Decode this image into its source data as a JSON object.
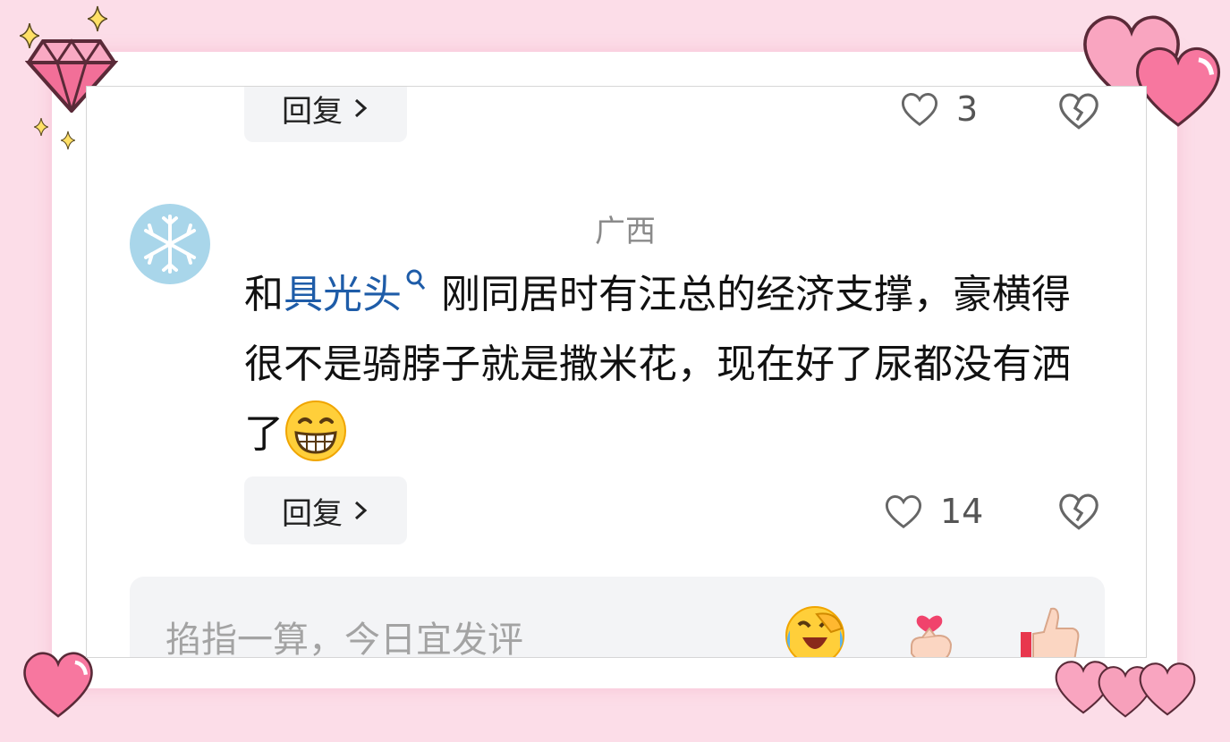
{
  "prev_comment": {
    "reply_label": "回复",
    "like_count": "3"
  },
  "comment": {
    "location": "广西",
    "text_before": "和",
    "mention": "具光头",
    "text_after": "刚同居时有汪总的经济支撑，豪横得很不是骑脖子就是撒米花，现在好了尿都没有洒了",
    "emoji": "grinning-face-emoji",
    "reply_label": "回复",
    "like_count": "14"
  },
  "input": {
    "placeholder": "掐指一算，今日宜发评",
    "quick_emojis": [
      "laugh-cry-emoji",
      "finger-heart-emoji",
      "thumbs-up-emoji"
    ]
  },
  "colors": {
    "background": "#fcdde8",
    "mention": "#1e5ca8",
    "heart_deco": "#f7779f"
  }
}
